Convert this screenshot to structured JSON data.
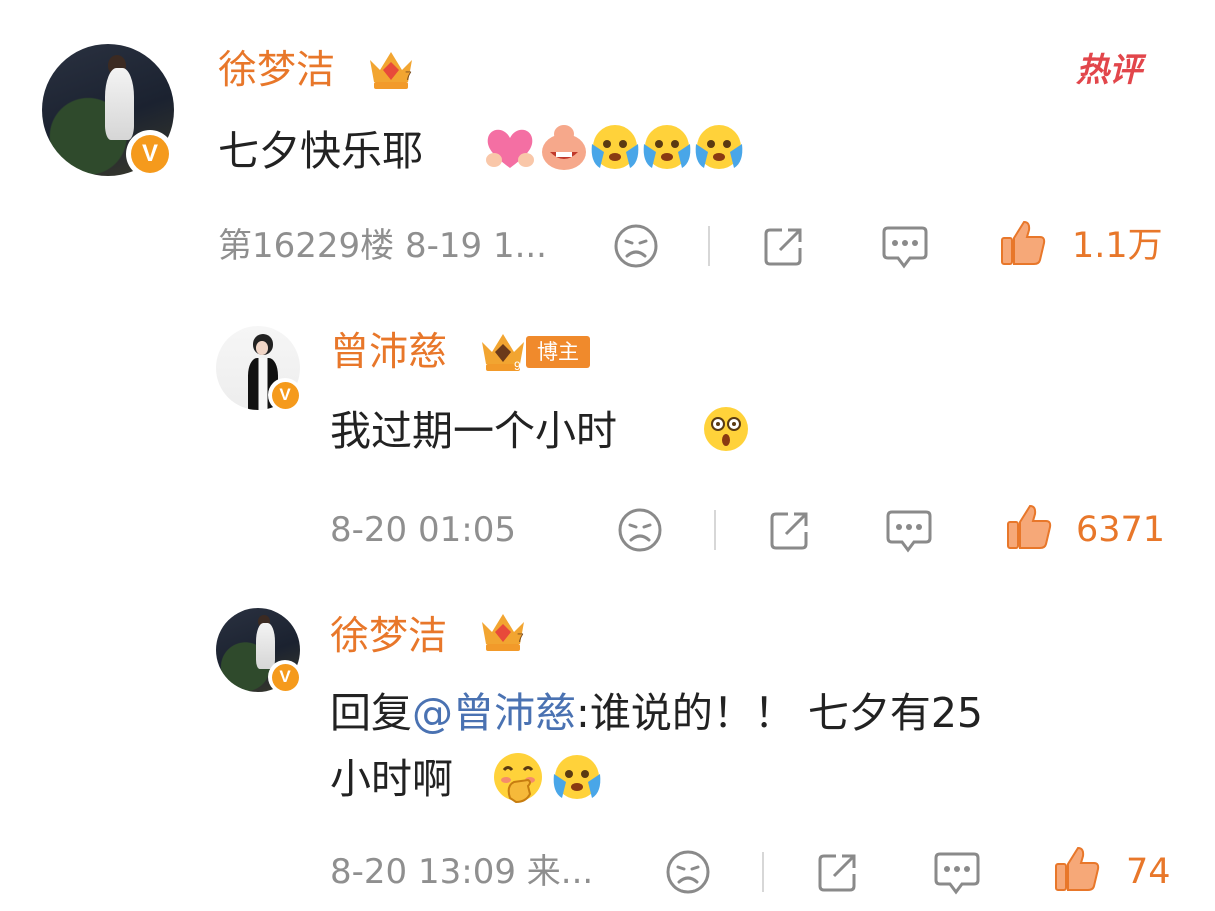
{
  "hot_badge": "热评",
  "main_comment": {
    "author": "徐梦洁",
    "text": "七夕快乐耶",
    "meta": "第16229楼 8-19 1...",
    "likes": "1.1万",
    "emojis": [
      "heart-emoji",
      "pig-laugh-emoji",
      "cry-emoji",
      "cry-emoji",
      "cry-emoji"
    ]
  },
  "replies": [
    {
      "author": "曾沛慈",
      "badge": "博主",
      "text": "我过期一个小时",
      "meta": "8-20 01:05",
      "likes": "6371",
      "emojis": [
        "shocked-emoji"
      ]
    },
    {
      "author": "徐梦洁",
      "reply_prefix": "回复",
      "mention": "@曾沛慈",
      "text_line1": ":谁说的！！ 七夕有25",
      "text_line2": "小时啊",
      "meta": "8-20 13:09 来...",
      "likes": "74",
      "emojis": [
        "cover-mouth-emoji",
        "cry-emoji"
      ]
    }
  ],
  "colors": {
    "name": "#e8772a",
    "like": "#e8772a",
    "meta": "#8f8f8f",
    "mention": "#4a72b2",
    "hot": "#e2464b"
  }
}
